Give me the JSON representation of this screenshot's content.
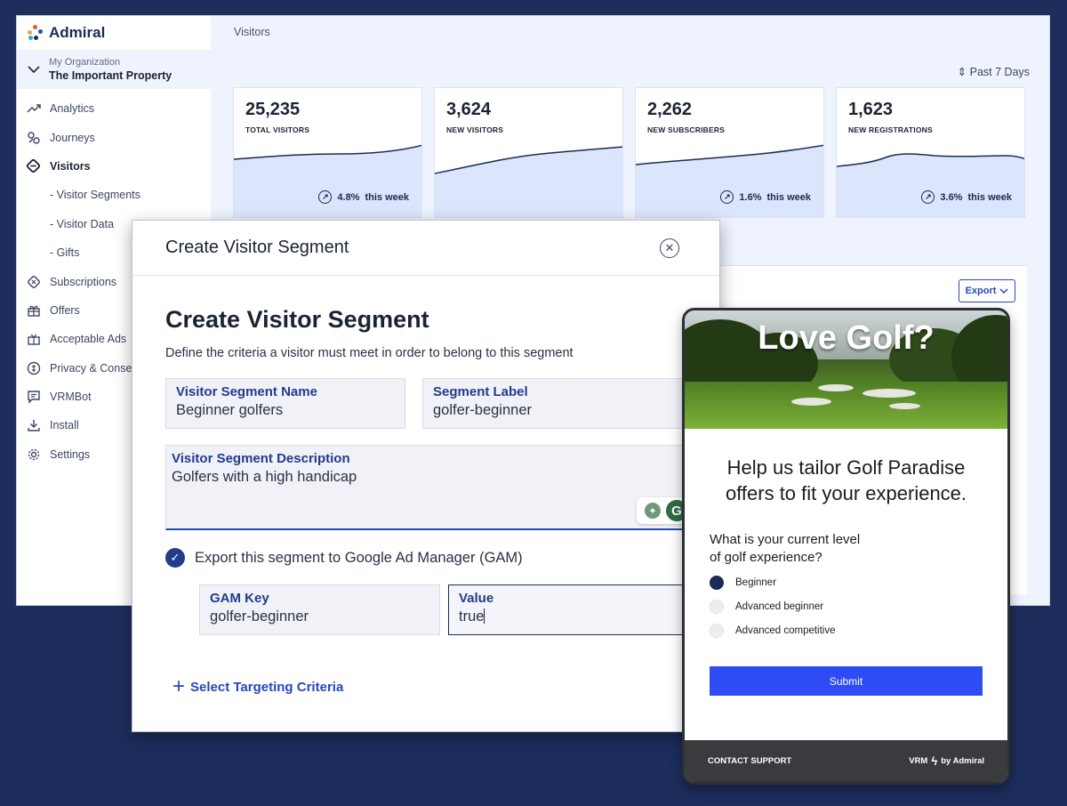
{
  "app": {
    "brand": "Admiral",
    "org_label": "My Organization",
    "property_name": "The Important Property",
    "breadcrumb": "Visitors",
    "date_range": "Past 7 Days"
  },
  "sidebar": {
    "items": [
      {
        "label": "Analytics",
        "icon": "trend-icon"
      },
      {
        "label": "Journeys",
        "icon": "journeys-icon"
      },
      {
        "label": "Visitors",
        "icon": "visitors-icon"
      },
      {
        "label": "- Visitor Segments"
      },
      {
        "label": "- Visitor Data"
      },
      {
        "label": "- Gifts"
      },
      {
        "label": "Subscriptions",
        "icon": "subscriptions-icon"
      },
      {
        "label": "Offers",
        "icon": "offers-icon"
      },
      {
        "label": "Acceptable Ads",
        "icon": "acceptable-ads-icon"
      },
      {
        "label": "Privacy & Conse",
        "icon": "privacy-icon"
      },
      {
        "label": "VRMBot",
        "icon": "chat-icon"
      },
      {
        "label": "Install",
        "icon": "download-icon"
      },
      {
        "label": "Settings",
        "icon": "gear-icon"
      }
    ]
  },
  "stats": [
    {
      "value": "25,235",
      "label": "TOTAL VISITORS",
      "trend_pct": "4.8%",
      "trend_text": "this week"
    },
    {
      "value": "3,624",
      "label": "NEW VISITORS",
      "trend_pct": "",
      "trend_text": ""
    },
    {
      "value": "2,262",
      "label": "NEW SUBSCRIBERS",
      "trend_pct": "1.6%",
      "trend_text": "this week"
    },
    {
      "value": "1,623",
      "label": "NEW REGISTRATIONS",
      "trend_pct": "3.6%",
      "trend_text": "this week"
    }
  ],
  "panel": {
    "export_label": "Export"
  },
  "modal": {
    "header_title": "Create Visitor Segment",
    "title": "Create Visitor Segment",
    "description": "Define the criteria a visitor must meet in order to belong to this segment",
    "fields": {
      "name": {
        "label": "Visitor Segment Name",
        "value": "Beginner golfers"
      },
      "segment_label": {
        "label": "Segment Label",
        "value": "golfer-beginner"
      },
      "description": {
        "label": "Visitor Segment Description",
        "value": "Golfers with a high handicap"
      },
      "gam_key": {
        "label": "GAM Key",
        "value": "golfer-beginner"
      },
      "gam_value": {
        "label": "Value",
        "value": "true"
      }
    },
    "export_checkbox_label": "Export this segment to Google Ad Manager (GAM)",
    "export_checked": true,
    "add_criteria_label": "Select Targeting Criteria"
  },
  "survey": {
    "hero_title": "Love Golf?",
    "heading_line1": "Help us tailor Golf Paradise",
    "heading_line2": "offers to fit your experience.",
    "question_line1": "What is your current level",
    "question_line2": "of golf experience?",
    "options": [
      {
        "label": "Beginner",
        "selected": true
      },
      {
        "label": "Advanced beginner",
        "selected": false
      },
      {
        "label": "Advanced competitive",
        "selected": false
      }
    ],
    "submit_label": "Submit",
    "footer_support": "CONTACT SUPPORT",
    "footer_brand_prefix": "VRM",
    "footer_brand_suffix": "by Admiral"
  },
  "colors": {
    "background": "#1d2d5c",
    "accent": "#2747b9",
    "submit": "#2e4cf5",
    "chart_fill": "#dbe5fb",
    "chart_line": "#1d2a55"
  }
}
